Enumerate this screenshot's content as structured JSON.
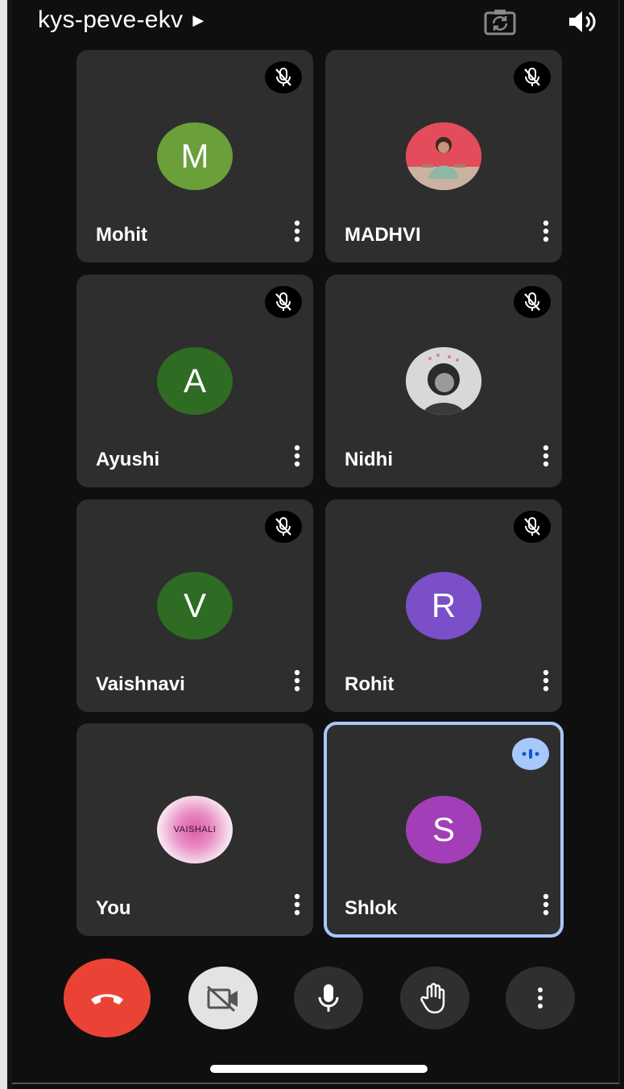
{
  "meeting": {
    "code": "kys-peve-ekv"
  },
  "topbar": {
    "camera_switch_icon": "camera-flip-icon",
    "speaker_icon": "speaker-icon"
  },
  "participants": [
    {
      "name": "Mohit",
      "initial": "M",
      "avatar_color": "#6a9f3a",
      "muted": true,
      "avatar_type": "initial"
    },
    {
      "name": "MADHVI",
      "initial": "",
      "avatar_color": "#d85555",
      "muted": true,
      "avatar_type": "photo"
    },
    {
      "name": "Ayushi",
      "initial": "A",
      "avatar_color": "#2e6b23",
      "muted": true,
      "avatar_type": "initial"
    },
    {
      "name": "Nidhi",
      "initial": "",
      "avatar_color": "#bdbdbd",
      "muted": true,
      "avatar_type": "photo"
    },
    {
      "name": "Vaishnavi",
      "initial": "V",
      "avatar_color": "#2e6b23",
      "muted": true,
      "avatar_type": "initial"
    },
    {
      "name": "Rohit",
      "initial": "R",
      "avatar_color": "#7a4fc8",
      "muted": true,
      "avatar_type": "initial"
    },
    {
      "name": "You",
      "initial": "",
      "avatar_color": "#f3e6ef",
      "muted": false,
      "avatar_type": "logo",
      "logo_text": "VAISHALI"
    },
    {
      "name": "Shlok",
      "initial": "S",
      "avatar_color": "#a23fb8",
      "muted": false,
      "speaking": true,
      "avatar_type": "initial"
    }
  ],
  "controls": {
    "end_call_color": "#ea4335",
    "camera_off_bg": "#e3e3e3",
    "button_bg": "#2f2f2f"
  }
}
